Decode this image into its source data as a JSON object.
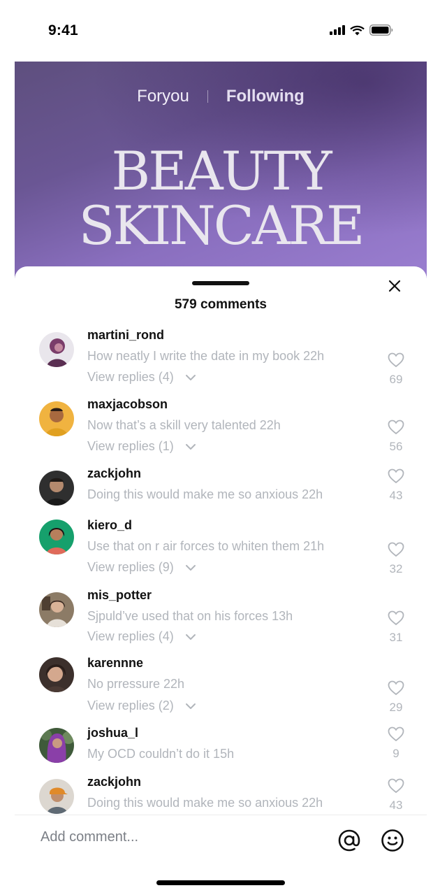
{
  "status_bar": {
    "time": "9:41"
  },
  "hero": {
    "tabs": [
      {
        "label": "Foryou"
      },
      {
        "label": "Following"
      }
    ],
    "title_line1": "BEAUTY",
    "title_line2": "SKINCARE"
  },
  "sheet": {
    "comments_count": "579 comments",
    "comments": [
      {
        "username": "martini_rond",
        "text": "How neatly I write the date in my book 22h",
        "replies": "View replies (4)",
        "likes": "69",
        "avatar_color": "#6b3a5c"
      },
      {
        "username": "maxjacobson",
        "text": "Now that’s a skill very talented 22h",
        "replies": "View replies (1)",
        "likes": "56",
        "avatar_color": "#e5a93a"
      },
      {
        "username": "zackjohn",
        "text": "Doing this would make me so anxious 22h",
        "replies": "",
        "likes": "43",
        "avatar_color": "#3b3b3b"
      },
      {
        "username": "kiero_d",
        "text": "Use that on r air forces to whiten them 21h",
        "replies": "View replies (9)",
        "likes": "32",
        "avatar_color": "#1a9a6a"
      },
      {
        "username": "mis_potter",
        "text": "Sjpuld’ve used that on his forces 13h",
        "replies": "View replies (4)",
        "likes": "31",
        "avatar_color": "#7a6a5a"
      },
      {
        "username": "karennne",
        "text": "No prressure 22h",
        "replies": "View replies (2)",
        "likes": "29",
        "avatar_color": "#5a4a48"
      },
      {
        "username": "joshua_l",
        "text": "My OCD couldn’t do it 15h",
        "replies": "",
        "likes": "9",
        "avatar_color": "#7a3f8f"
      },
      {
        "username": "zackjohn",
        "text": "Doing this would make me so anxious 22h",
        "replies": "",
        "likes": "43",
        "avatar_color": "#c9a27a"
      }
    ]
  },
  "composer": {
    "placeholder": "Add comment..."
  },
  "colors": {
    "muted_text": "#b1b5bb",
    "hero_purple": "#7a62ab"
  }
}
